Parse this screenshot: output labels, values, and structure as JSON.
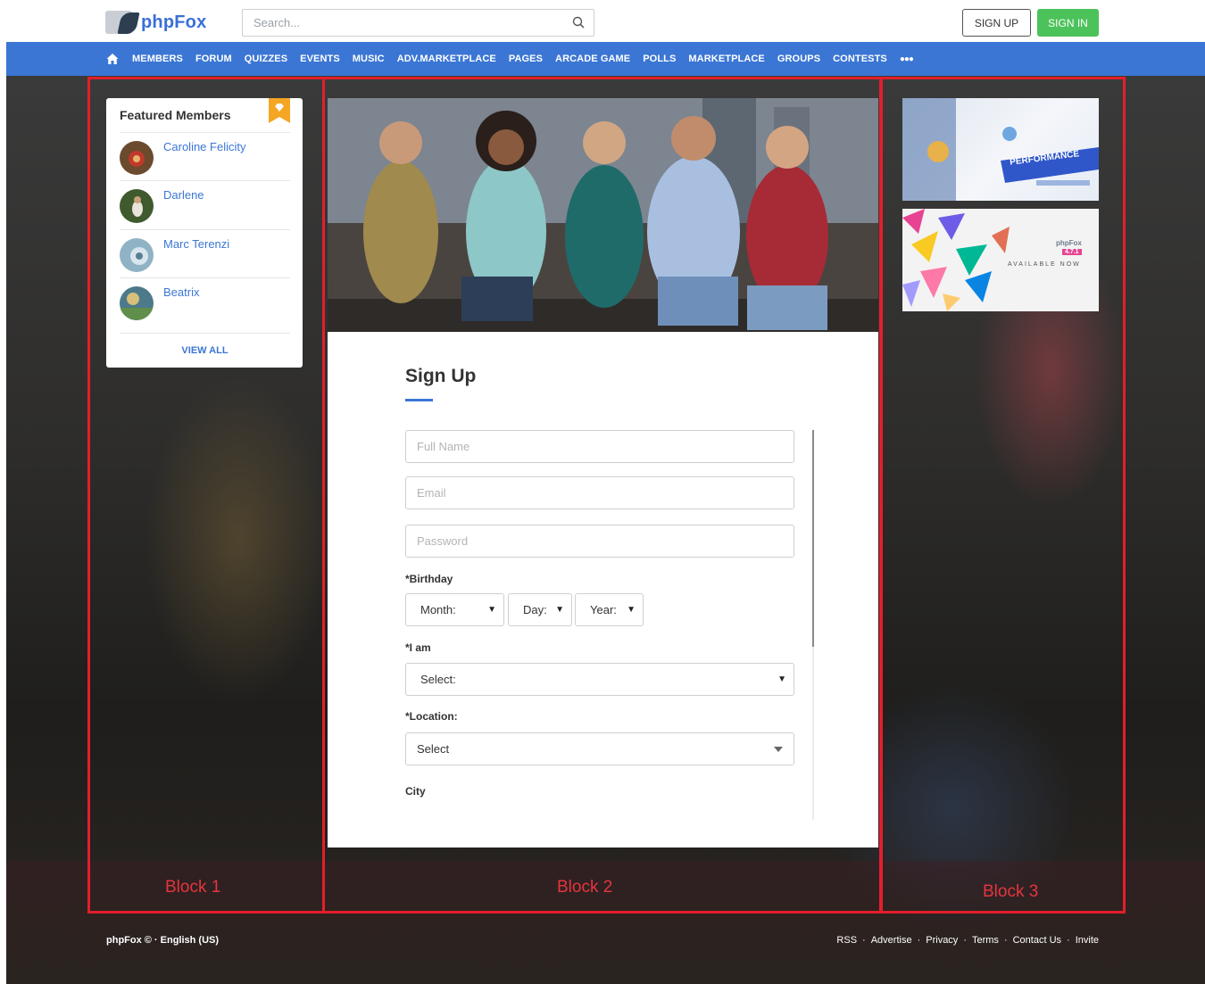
{
  "header": {
    "logo_text": "phpFox",
    "search_placeholder": "Search...",
    "signup_label": "SIGN UP",
    "signin_label": "SIGN IN"
  },
  "nav": {
    "items": [
      "MEMBERS",
      "FORUM",
      "QUIZZES",
      "EVENTS",
      "MUSIC",
      "ADV.MARKETPLACE",
      "PAGES",
      "ARCADE GAME",
      "POLLS",
      "MARKETPLACE",
      "GROUPS",
      "CONTESTS"
    ],
    "more_label": "●●●"
  },
  "featured": {
    "title": "Featured Members",
    "members": [
      {
        "name": "Caroline Felicity"
      },
      {
        "name": "Darlene"
      },
      {
        "name": "Marc Terenzi"
      },
      {
        "name": "Beatrix"
      }
    ],
    "view_all": "VIEW ALL"
  },
  "signup": {
    "title": "Sign Up",
    "full_name_placeholder": "Full Name",
    "email_placeholder": "Email",
    "password_placeholder": "Password",
    "birthday_label": "*Birthday",
    "month": "Month:",
    "day": "Day:",
    "year": "Year:",
    "i_am_label": "*I am",
    "i_am_value": "Select:",
    "location_label": "*Location:",
    "location_value": "Select",
    "city_label": "City"
  },
  "ads": {
    "ad1_text": "PERFORMANCE",
    "ad2_brand": "phpFox",
    "ad2_version": "4.7.1",
    "ad2_text": "AVAILABLE NOW"
  },
  "annotations": {
    "block1": "Block 1",
    "block2": "Block 2",
    "block3": "Block 3"
  },
  "footer": {
    "left": "phpFox © · English (US)",
    "links": [
      "RSS",
      "Advertise",
      "Privacy",
      "Terms",
      "Contact Us",
      "Invite"
    ]
  },
  "colors": {
    "brand_blue": "#3b76d4",
    "signin_green": "#4cc25a",
    "annotation_red": "#e21f2b",
    "badge_orange": "#f5a623"
  },
  "icons": {
    "home": "home-icon",
    "search": "search-icon",
    "featured": "diamond-badge-icon"
  }
}
